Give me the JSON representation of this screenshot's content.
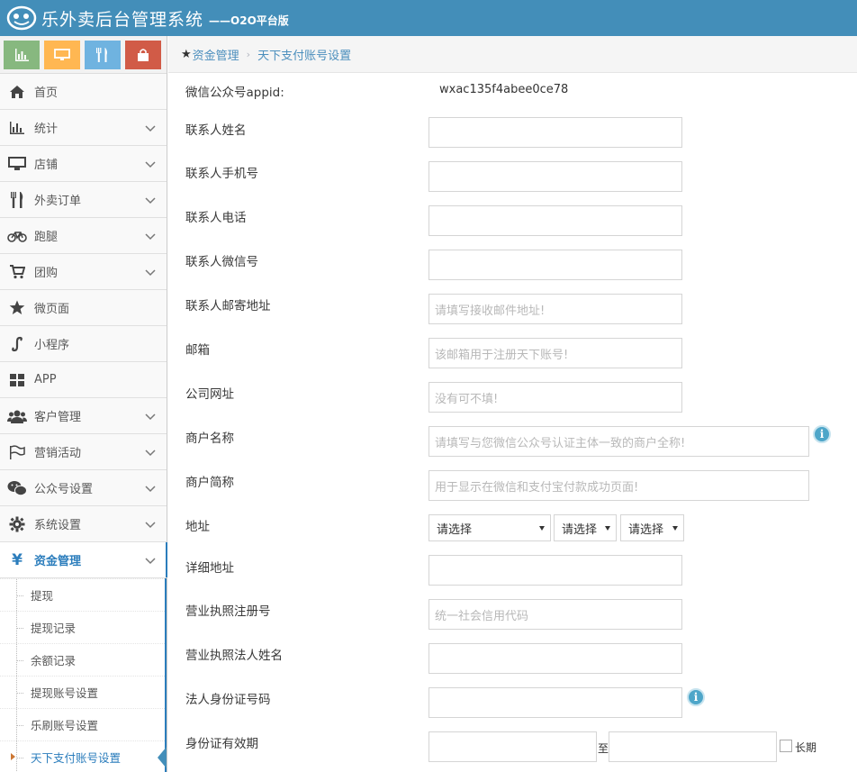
{
  "header": {
    "title": "乐外卖后台管理系统",
    "subtitle": "——O2O平台版"
  },
  "shortcuts": [
    {
      "icon": "bar-chart-icon",
      "color": "#87b87f"
    },
    {
      "icon": "monitor-icon",
      "color": "#ffb752"
    },
    {
      "icon": "utensils-icon",
      "color": "#6fb3e0"
    },
    {
      "icon": "shopping-bag-icon",
      "color": "#d15b47"
    }
  ],
  "sidebar": {
    "items": [
      {
        "label": "首页",
        "icon": "home-icon",
        "has_children": false
      },
      {
        "label": "统计",
        "icon": "bar-chart-icon",
        "has_children": true
      },
      {
        "label": "店铺",
        "icon": "monitor-icon",
        "has_children": true
      },
      {
        "label": "外卖订单",
        "icon": "utensils-icon",
        "has_children": true
      },
      {
        "label": "跑腿",
        "icon": "bicycle-icon",
        "has_children": true
      },
      {
        "label": "团购",
        "icon": "cart-icon",
        "has_children": true
      },
      {
        "label": "微页面",
        "icon": "star-icon",
        "has_children": false
      },
      {
        "label": "小程序",
        "icon": "link-icon",
        "has_children": false
      },
      {
        "label": "APP",
        "icon": "grid-icon",
        "has_children": false
      },
      {
        "label": "客户管理",
        "icon": "users-icon",
        "has_children": true
      },
      {
        "label": "营销活动",
        "icon": "flag-icon",
        "has_children": true
      },
      {
        "label": "公众号设置",
        "icon": "wechat-icon",
        "has_children": true
      },
      {
        "label": "系统设置",
        "icon": "gear-icon",
        "has_children": true
      },
      {
        "label": "资金管理",
        "icon": "yen-icon",
        "has_children": true,
        "active": true
      }
    ],
    "submenu": [
      {
        "label": "提现"
      },
      {
        "label": "提现记录"
      },
      {
        "label": "余额记录"
      },
      {
        "label": "提现账号设置"
      },
      {
        "label": "乐刷账号设置"
      },
      {
        "label": "天下支付账号设置",
        "current": true
      }
    ]
  },
  "breadcrumb": {
    "root": "资金管理",
    "current": "天下支付账号设置"
  },
  "form": {
    "appid_label": "微信公众号appid:",
    "appid_value": "wxac135f4abee0ce78",
    "contact_name_label": "联系人姓名",
    "contact_name_value": "",
    "contact_mobile_label": "联系人手机号",
    "contact_mobile_value": "",
    "contact_phone_label": "联系人电话",
    "contact_phone_value": "",
    "contact_wechat_label": "联系人微信号",
    "contact_wechat_value": "",
    "contact_mail_label": "联系人邮寄地址",
    "contact_mail_placeholder": "请填写接收邮件地址!",
    "email_label": "邮箱",
    "email_placeholder": "该邮箱用于注册天下账号!",
    "website_label": "公司网址",
    "website_placeholder": "没有可不填!",
    "merchant_name_label": "商户名称",
    "merchant_name_placeholder": "请填写与您微信公众号认证主体一致的商户全称!",
    "merchant_short_label": "商户简称",
    "merchant_short_placeholder": "用于显示在微信和支付宝付款成功页面!",
    "address_label": "地址",
    "province_select": "请选择",
    "city_select": "请选择",
    "district_select": "请选择",
    "detail_address_label": "详细地址",
    "license_no_label": "营业执照注册号",
    "license_no_placeholder": "统一社会信用代码",
    "legal_name_label": "营业执照法人姓名",
    "id_no_label": "法人身份证号码",
    "id_validity_label": "身份证有效期",
    "to_text": "至",
    "long_term_label": "长期"
  }
}
